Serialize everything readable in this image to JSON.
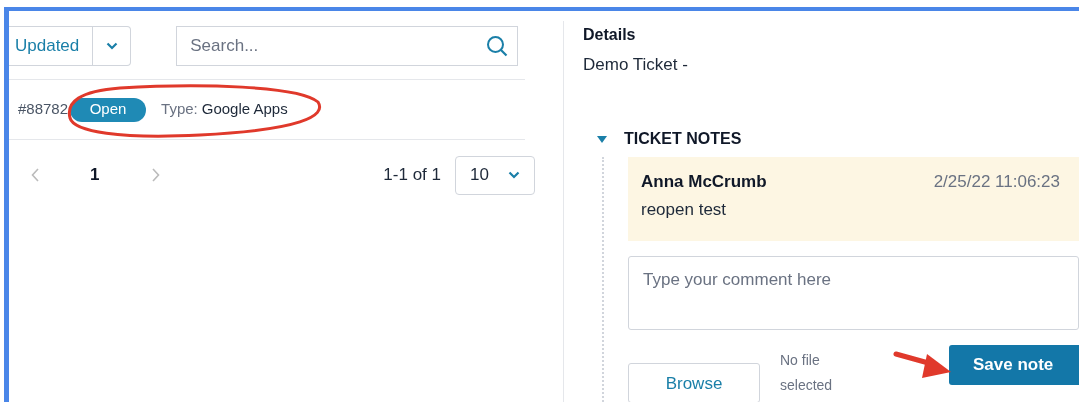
{
  "list_pane": {
    "sort": {
      "label": "Updated"
    },
    "search": {
      "placeholder": "Search..."
    },
    "tickets": [
      {
        "number": "#88782",
        "status": "Open",
        "type_label": "Type:",
        "type_value": "Google Apps"
      }
    ],
    "pagination": {
      "pages": [
        {
          "label": "1",
          "selected": true
        }
      ],
      "range": "1-1 of 1",
      "per_page": "10"
    }
  },
  "details": {
    "heading": "Details",
    "title": "Demo Ticket -",
    "notes_section": {
      "title": "TICKET NOTES",
      "expanded": true,
      "notes": [
        {
          "author": "Anna McCrumb",
          "time": "2/25/22 11:06:23",
          "text": "reopen test"
        }
      ],
      "comment": {
        "placeholder": "Type your comment here"
      },
      "browse_button": "Browse",
      "file_status": "No file selected",
      "save_button": "Save note"
    }
  }
}
